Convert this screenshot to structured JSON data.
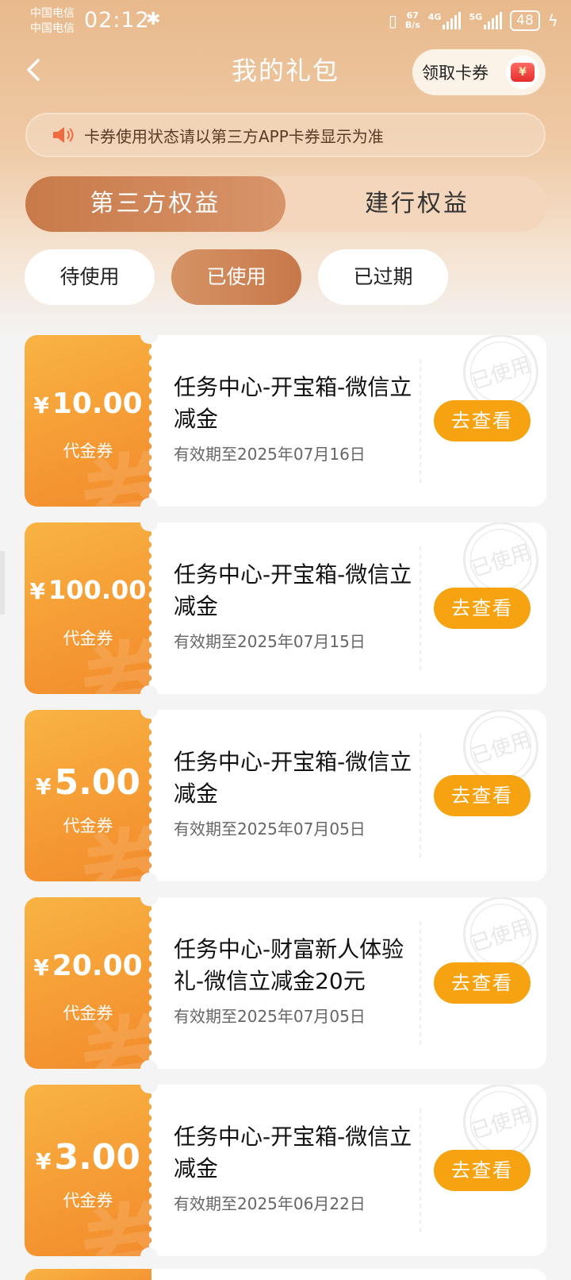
{
  "status_bar": {
    "carrier1": "中国电信",
    "carrier2": "中国电信",
    "time": "02:12",
    "speed_value": "67",
    "speed_unit": "B/s",
    "network1": "4G",
    "network2": "5G",
    "battery": "48"
  },
  "header": {
    "title": "我的礼包",
    "claim_button": "领取卡券",
    "wallet_symbol": "¥"
  },
  "notice": {
    "text": "卡券使用状态请以第三方APP卡券显示为准"
  },
  "tabs": [
    "第三方权益",
    "建行权益"
  ],
  "active_tab": 0,
  "filters": [
    "待使用",
    "已使用",
    "已过期"
  ],
  "active_filter": 1,
  "currency_symbol": "¥",
  "coupons": [
    {
      "amount": "10.00",
      "type": "代金券",
      "title": "任务中心-开宝箱-微信立减金",
      "expiry": "有效期至2025年07月16日",
      "button": "去查看",
      "stamp": "已使用"
    },
    {
      "amount": "100.00",
      "type": "代金券",
      "title": "任务中心-开宝箱-微信立减金",
      "expiry": "有效期至2025年07月15日",
      "button": "去查看",
      "stamp": "已使用"
    },
    {
      "amount": "5.00",
      "type": "代金券",
      "title": "任务中心-开宝箱-微信立减金",
      "expiry": "有效期至2025年07月05日",
      "button": "去查看",
      "stamp": "已使用"
    },
    {
      "amount": "20.00",
      "type": "代金券",
      "title": "任务中心-财富新人体验礼-微信立减金20元",
      "expiry": "有效期至2025年07月05日",
      "button": "去查看",
      "stamp": "已使用"
    },
    {
      "amount": "3.00",
      "type": "代金券",
      "title": "任务中心-开宝箱-微信立减金",
      "expiry": "有效期至2025年06月22日",
      "button": "去查看",
      "stamp": "已使用"
    }
  ],
  "colors": {
    "accent_orange": "#f7a311",
    "tab_active": "#c87a49",
    "stub_orange": "#f59a34"
  }
}
